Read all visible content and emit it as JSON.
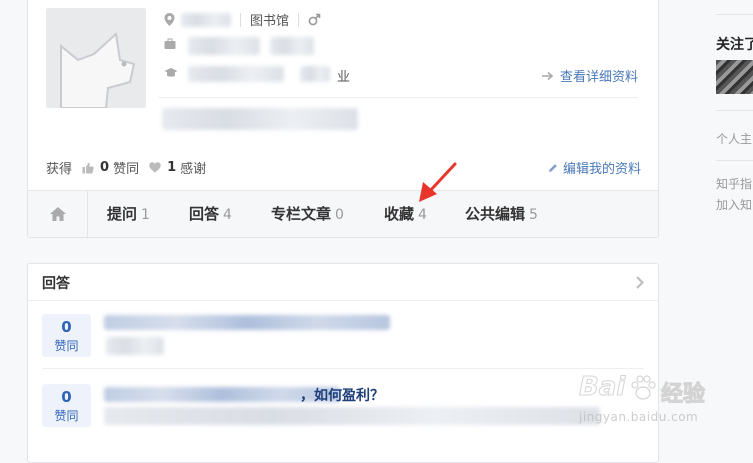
{
  "profile": {
    "location_suffix": "图书馆",
    "gender_icon": "male-icon",
    "education_suffix": "业",
    "view_details": "查看详细资料",
    "stats_label": "获得",
    "agree_count": "0",
    "agree_label": "赞同",
    "thanks_count": "1",
    "thanks_label": "感谢",
    "edit_profile": "编辑我的资料"
  },
  "tabs": [
    {
      "label": "提问",
      "count": "1"
    },
    {
      "label": "回答",
      "count": "4"
    },
    {
      "label": "专栏文章",
      "count": "0"
    },
    {
      "label": "收藏",
      "count": "4"
    },
    {
      "label": "公共编辑",
      "count": "5"
    }
  ],
  "answers_section": {
    "title": "回答",
    "items": [
      {
        "votes": "0",
        "vote_label": "赞同",
        "title_visible": ""
      },
      {
        "votes": "0",
        "vote_label": "赞同",
        "title_visible": "，如何盈利？"
      }
    ]
  },
  "sidebar": {
    "following_title": "关注了",
    "personal_home": "个人主",
    "zhihu_line1": "知乎指",
    "zhihu_line2": "加入知"
  },
  "watermark": {
    "brand": "Bai",
    "brand2": "经验",
    "url": "jingyan.baidu.com"
  },
  "colors": {
    "accent": "#2f63b8",
    "arrow": "#e8362d"
  }
}
